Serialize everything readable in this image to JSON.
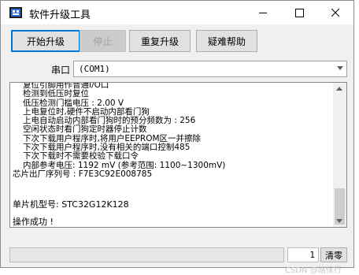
{
  "window": {
    "title": "软件升级工具",
    "icon": "app-icon",
    "controls": [
      "minimize-icon",
      "maximize-icon",
      "close-icon"
    ]
  },
  "toolbar": {
    "start_label": "开始升级",
    "stop_label": "停止",
    "repeat_label": "重复升级",
    "help_label": "疑难帮助"
  },
  "port": {
    "label": "串口",
    "value": "(COM1)"
  },
  "log": {
    "lines": [
      "复位引脚用作普通I/O口",
      "检测到低压时复位",
      "低压检测门槛电压 : 2.00 V",
      "上电复位时,硬件不启动内部看门狗",
      "上电自动启动内部看门狗时的预分频数为 : 256",
      "空闲状态时看门狗定时器停止计数",
      "下次下载用户程序时,将用户EEPROM区一并擦除",
      "下次下载用户程序时,没有相关的端口控制485",
      "下次下载时不需要校验下载口令",
      "内部参考电压: 1192 mV (参考范围: 1100~1300mV)",
      "芯片出厂序列号 : F7E3C92E008785"
    ],
    "chip_model": "单片机型号: STC32G12K128",
    "result": "操作成功 !"
  },
  "status": {
    "progress_fraction": 0,
    "count": "1",
    "clear_label": "清零",
    "progress_color": "#06b025"
  },
  "watermark": "CSDN @路保行"
}
